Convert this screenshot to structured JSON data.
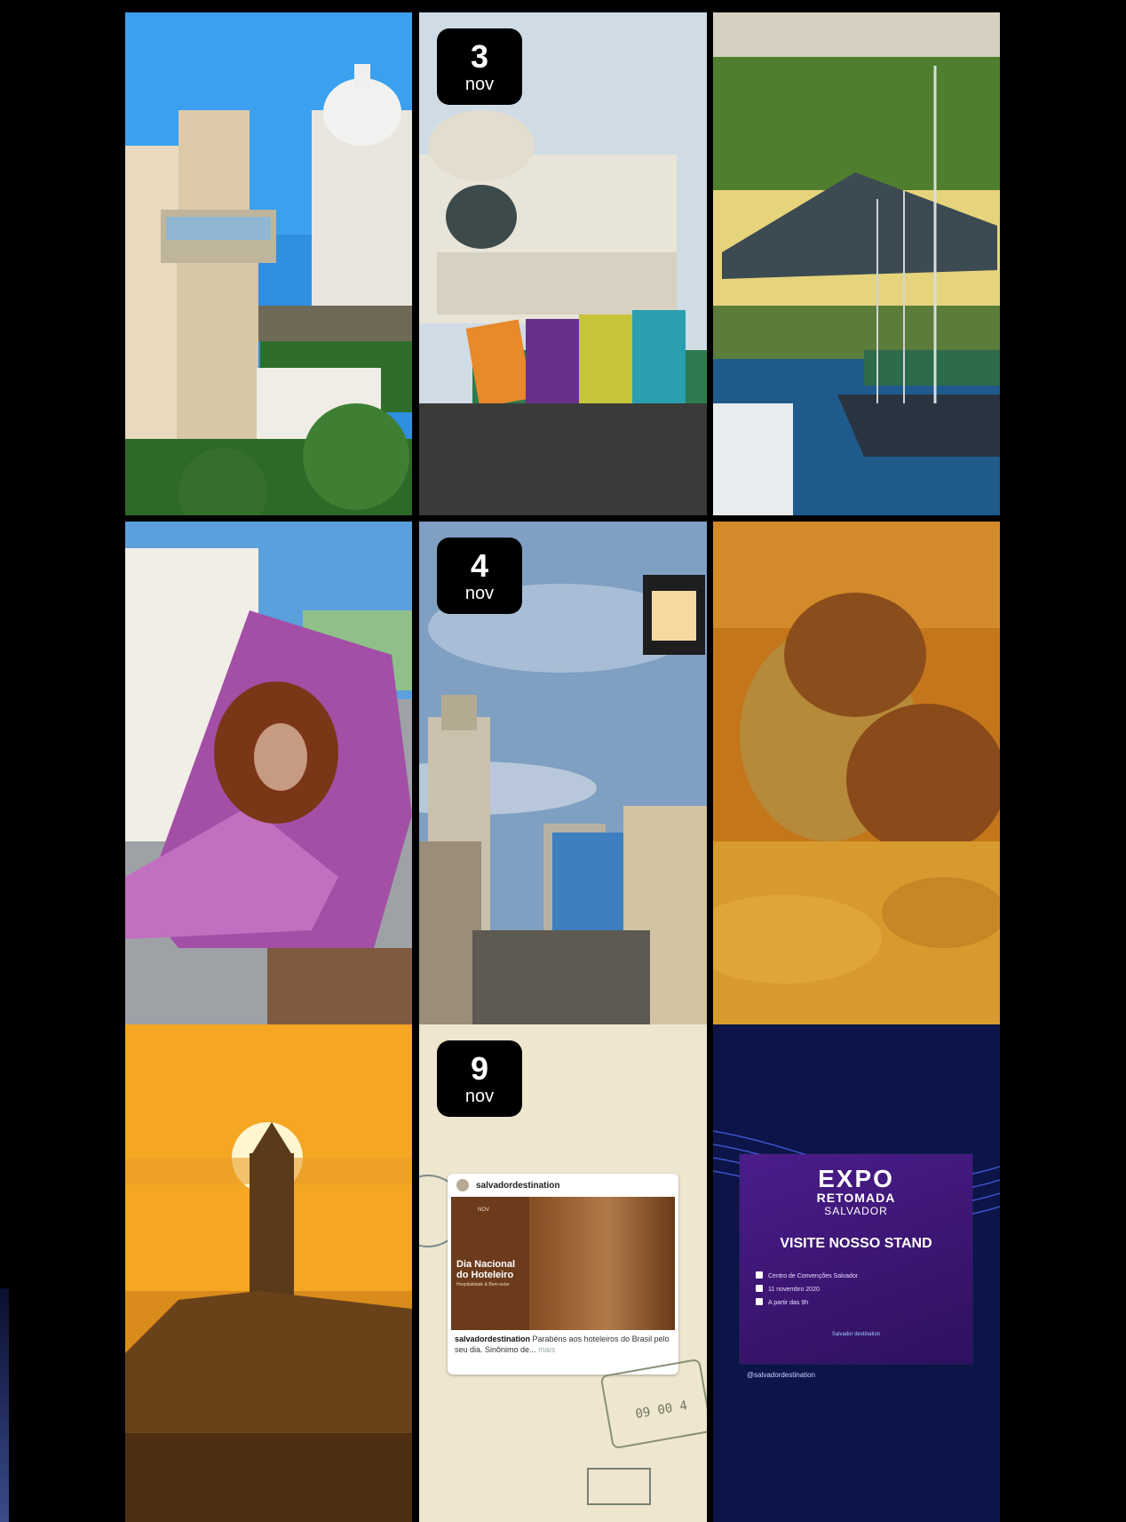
{
  "tiles": [
    {
      "id": "elevador-lacerda",
      "badge": null
    },
    {
      "id": "palacio-rio-branco",
      "badge": {
        "day": "3",
        "month": "nov"
      }
    },
    {
      "id": "mercado-modelo-harbor",
      "badge": null
    },
    {
      "id": "acaraje-pelourinho",
      "badge": null
    },
    {
      "id": "pelourinho-street",
      "badge": {
        "day": "4",
        "month": "nov"
      }
    },
    {
      "id": "acaraje-frying",
      "badge": null
    },
    {
      "id": "farol-da-barra-sunset",
      "badge": null
    },
    {
      "id": "dia-do-hoteleiro",
      "badge": {
        "day": "9",
        "month": "nov"
      }
    },
    {
      "id": "expo-retomada",
      "badge": null
    }
  ],
  "hoteleiro_card": {
    "account": "salvadordestination",
    "img_month": "NOV",
    "img_title": "Dia Nacional do Hoteleiro",
    "img_subtitle": "Hospitalidade & Bem-estar",
    "caption_user": "salvadordestination",
    "caption_text": " Parabéns aos hoteleiros do Brasil pelo seu dia. Sinônimo de...",
    "caption_more": " mais",
    "stamp_text": "09 00 4"
  },
  "expo_card": {
    "logo_line1": "EXPO",
    "logo_line2": "RETOMADA",
    "logo_line3": "SALVADOR",
    "headline": "VISITE NOSSO STAND",
    "info": [
      "Centro de Convenções Salvador",
      "11 novembro 2020",
      "A partir das 9h"
    ],
    "brand": "Salvador destination",
    "handle": "@salvadordestination"
  },
  "colors": {
    "background": "#000000",
    "badge_bg": "#000000",
    "badge_text": "#ffffff",
    "expo_purple": "#3a1570",
    "navy": "#0b1342"
  }
}
